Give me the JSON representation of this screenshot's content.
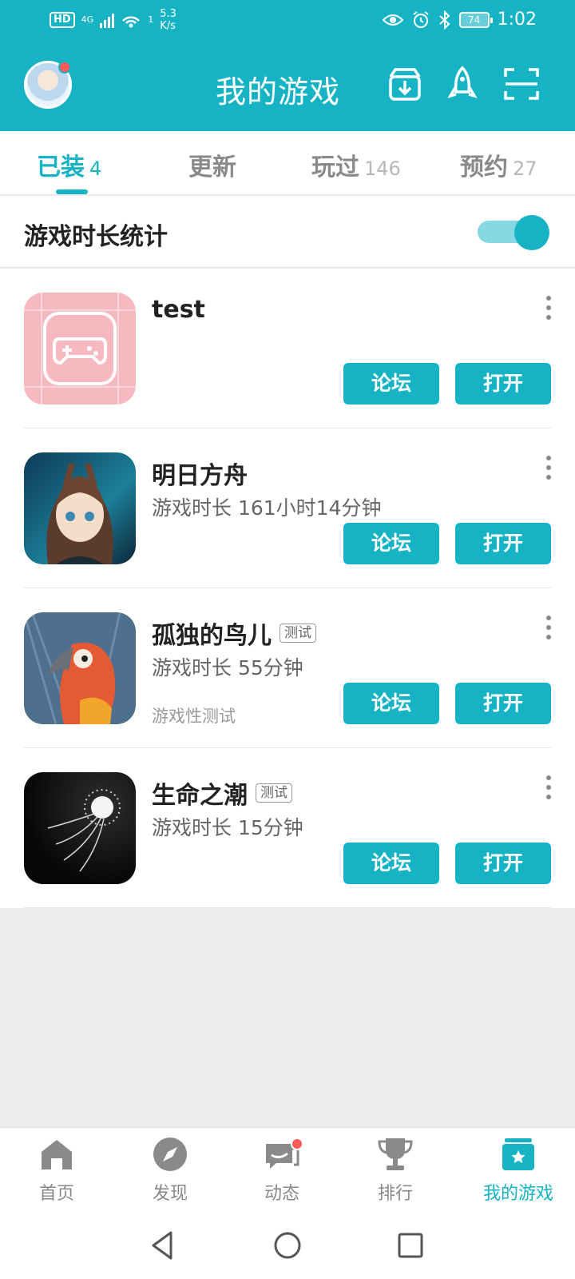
{
  "status_bar": {
    "hd": "HD",
    "network": "4G",
    "wifi_index": "1",
    "speed_value": "5.3",
    "speed_unit": "K/s",
    "battery": "74",
    "time": "1:02"
  },
  "header": {
    "title": "我的游戏",
    "avatar_has_notification": true,
    "icons": [
      "download-icon",
      "rocket-icon",
      "scan-icon"
    ]
  },
  "tabs": [
    {
      "label": "已装",
      "count": "4",
      "active": true
    },
    {
      "label": "更新",
      "count": "",
      "active": false
    },
    {
      "label": "玩过",
      "count": "146",
      "active": false
    },
    {
      "label": "预约",
      "count": "27",
      "active": false
    }
  ],
  "stats": {
    "label": "游戏时长统计",
    "enabled": true
  },
  "games": [
    {
      "name": "test",
      "tag": "",
      "playtime": "",
      "subtitle": "",
      "icon": "gamepad-placeholder-icon",
      "forum_label": "论坛",
      "open_label": "打开"
    },
    {
      "name": "明日方舟",
      "tag": "",
      "playtime": "游戏时长 161小时14分钟",
      "subtitle": "",
      "icon": "arknights-icon",
      "forum_label": "论坛",
      "open_label": "打开"
    },
    {
      "name": "孤独的鸟儿",
      "tag": "测试",
      "playtime": "游戏时长 55分钟",
      "subtitle": "游戏性测试",
      "icon": "parrot-icon",
      "forum_label": "论坛",
      "open_label": "打开"
    },
    {
      "name": "生命之潮",
      "tag": "测试",
      "playtime": "游戏时长 15分钟",
      "subtitle": "",
      "icon": "jellyfish-icon",
      "forum_label": "论坛",
      "open_label": "打开"
    }
  ],
  "bottom_nav": [
    {
      "label": "首页",
      "icon": "home-icon",
      "active": false
    },
    {
      "label": "发现",
      "icon": "compass-icon",
      "active": false
    },
    {
      "label": "动态",
      "icon": "chat-icon",
      "active": false,
      "has_notification": true
    },
    {
      "label": "排行",
      "icon": "trophy-icon",
      "active": false
    },
    {
      "label": "我的游戏",
      "icon": "my-games-icon",
      "active": true
    }
  ],
  "colors": {
    "accent": "#16b3c4",
    "notification": "#ff5a5a",
    "background": "#ededed"
  }
}
